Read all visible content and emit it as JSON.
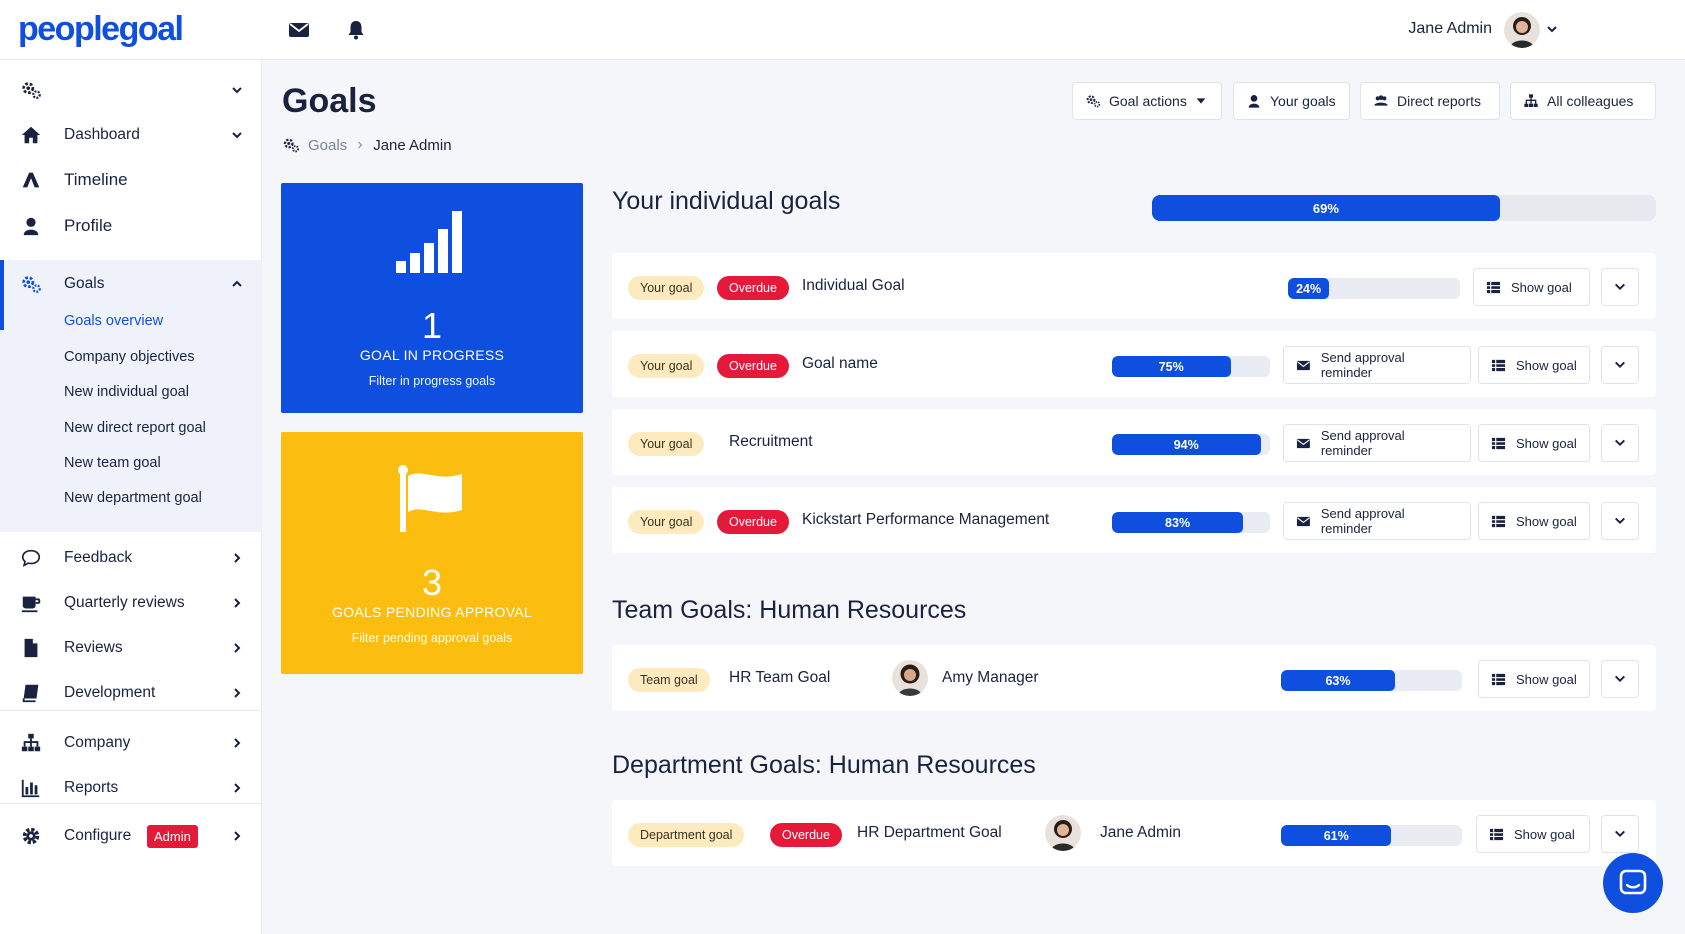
{
  "brand": {
    "logo_text": "peoplegoal",
    "accent": "#0f4fe0"
  },
  "topbar": {
    "user_name": "Jane Admin"
  },
  "sidebar": {
    "dashboard": "Dashboard",
    "timeline": "Timeline",
    "profile": "Profile",
    "goals": "Goals",
    "goals_sub": [
      "Goals overview",
      "Company objectives",
      "New individual goal",
      "New direct report goal",
      "New team goal",
      "New department goal"
    ],
    "feedback": "Feedback",
    "quarterly_reviews": "Quarterly reviews",
    "reviews": "Reviews",
    "development": "Development",
    "company": "Company",
    "reports": "Reports",
    "configure": "Configure",
    "admin_badge": "Admin"
  },
  "header": {
    "title": "Goals",
    "breadcrumb": [
      "Goals",
      "Jane Admin"
    ],
    "buttons": {
      "goal_actions": "Goal actions",
      "your_goals": "Your goals",
      "direct_reports": "Direct reports",
      "all_colleagues": "All colleagues"
    }
  },
  "cards": {
    "in_progress": {
      "count": "1",
      "caption": "GOAL IN PROGRESS",
      "link": "Filter in progress goals"
    },
    "pending": {
      "count": "3",
      "caption": "GOALS PENDING APPROVAL",
      "link": "Filter pending approval goals"
    }
  },
  "individual": {
    "title": "Your individual goals",
    "overall_progress": 69,
    "overall_label": "69%",
    "rows": [
      {
        "tag": "Your goal",
        "overdue": "Overdue",
        "name": "Individual Goal",
        "progress": 24,
        "progress_label": "24%",
        "show": "Show goal"
      },
      {
        "tag": "Your goal",
        "overdue": "Overdue",
        "name": "Goal name",
        "progress": 75,
        "progress_label": "75%",
        "reminder": "Send approval reminder",
        "show": "Show goal"
      },
      {
        "tag": "Your goal",
        "name": "Recruitment",
        "progress": 94,
        "progress_label": "94%",
        "reminder": "Send approval reminder",
        "show": "Show goal"
      },
      {
        "tag": "Your goal",
        "overdue": "Overdue",
        "name": "Kickstart Performance Management",
        "progress": 83,
        "progress_label": "83%",
        "reminder": "Send approval reminder",
        "show": "Show goal"
      }
    ]
  },
  "team": {
    "title": "Team Goals: Human Resources",
    "row": {
      "tag": "Team goal",
      "name": "HR Team Goal",
      "owner": "Amy Manager",
      "progress": 63,
      "progress_label": "63%",
      "show": "Show goal"
    }
  },
  "department": {
    "title": "Department Goals: Human Resources",
    "row": {
      "tag": "Department goal",
      "overdue": "Overdue",
      "name": "HR Department Goal",
      "owner": "Jane Admin",
      "progress": 61,
      "progress_label": "61%",
      "show": "Show goal"
    }
  }
}
